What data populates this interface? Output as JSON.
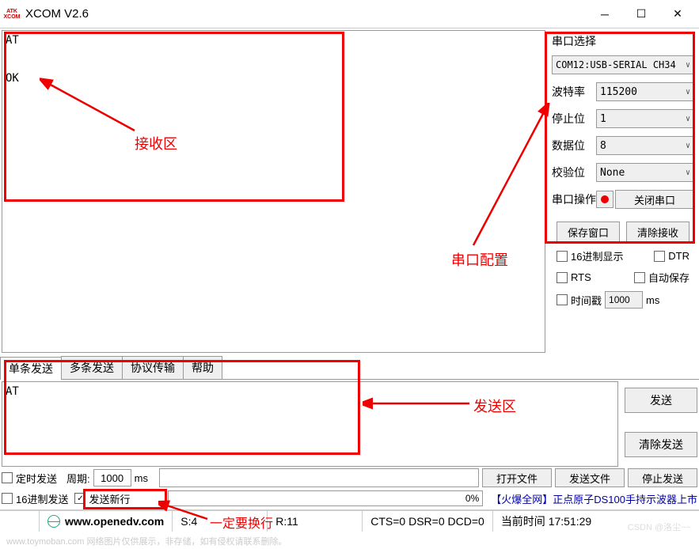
{
  "titlebar": {
    "app_icon_top": "ATK",
    "app_icon_bot": "XCOM",
    "title": "XCOM V2.6"
  },
  "receive": {
    "content": "AT\n\n\nOK"
  },
  "config": {
    "section_label": "串口选择",
    "port_value": "COM12:USB-SERIAL CH34",
    "baud_label": "波特率",
    "baud_value": "115200",
    "stop_label": "停止位",
    "stop_value": "1",
    "data_label": "数据位",
    "data_value": "8",
    "parity_label": "校验位",
    "parity_value": "None",
    "op_label": "串口操作",
    "close_port_label": "关闭串口",
    "save_window": "保存窗口",
    "clear_receive": "清除接收",
    "hex_display": "16进制显示",
    "dtr": "DTR",
    "rts": "RTS",
    "auto_save": "自动保存",
    "timestamp": "时间戳",
    "timestamp_val": "1000",
    "ms_unit": "ms"
  },
  "tabs": {
    "single": "单条发送",
    "multi": "多条发送",
    "protocol": "协议传输",
    "help": "帮助"
  },
  "send": {
    "content": "AT",
    "send_btn": "发送",
    "clear_btn": "清除发送"
  },
  "bottom": {
    "timed_send": "定时发送",
    "period_label": "周期:",
    "period_value": "1000",
    "ms_unit": "ms",
    "open_file": "打开文件",
    "send_file": "发送文件",
    "stop_send": "停止发送",
    "hex_send": "16进制发送",
    "send_newline": "发送新行",
    "progress_pct": "0%",
    "promo": "【火爆全网】正点原子DS100手持示波器上市"
  },
  "status": {
    "url": "www.openedv.com",
    "s_count": "S:4",
    "r_count": "R:11",
    "signals": "CTS=0 DSR=0 DCD=0",
    "time_label": "当前时间 17:51:29"
  },
  "annotations": {
    "receive_area": "接收区",
    "config_area": "串口配置",
    "send_area": "发送区",
    "newline_note": "一定要换行"
  },
  "watermark": "www.toymoban.com 网络图片仅供展示，非存储，如有侵权请联系删除。",
  "csdn": "CSDN @洛尘~~"
}
